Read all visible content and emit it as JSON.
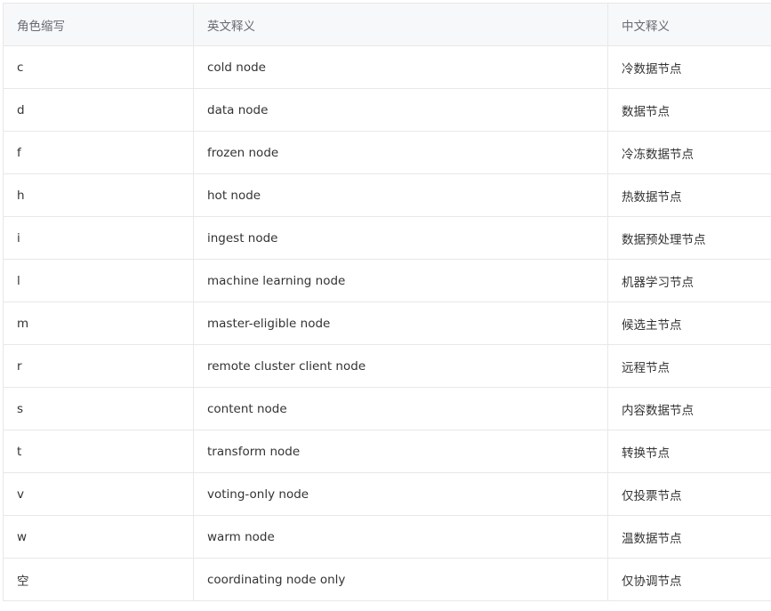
{
  "table": {
    "headers": [
      "角色缩写",
      "英文释义",
      "中文释义"
    ],
    "rows": [
      [
        "c",
        "cold node",
        "冷数据节点"
      ],
      [
        "d",
        "data node",
        "数据节点"
      ],
      [
        "f",
        "frozen node",
        "冷冻数据节点"
      ],
      [
        "h",
        "hot node",
        "热数据节点"
      ],
      [
        "i",
        "ingest node",
        "数据预处理节点"
      ],
      [
        "l",
        "machine learning node",
        "机器学习节点"
      ],
      [
        "m",
        "master-eligible node",
        "候选主节点"
      ],
      [
        "r",
        "remote cluster client node",
        "远程节点"
      ],
      [
        "s",
        "content node",
        "内容数据节点"
      ],
      [
        "t",
        "transform node",
        "转换节点"
      ],
      [
        "v",
        "voting-only node",
        "仅投票节点"
      ],
      [
        "w",
        "warm node",
        "温数据节点"
      ],
      [
        "空",
        "coordinating node only",
        "仅协调节点"
      ]
    ]
  }
}
